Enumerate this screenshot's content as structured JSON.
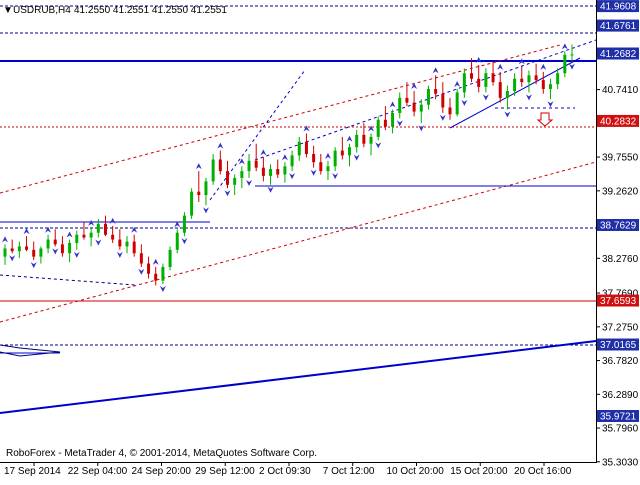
{
  "header": {
    "arrow": "▼",
    "symbol": "USDRUB,H4",
    "quote": "41.2550 41.2551 41.2550 41.2551"
  },
  "footer": {
    "copyright": "RoboForex - MetaTrader 4, © 2001-2014, MetaQuotes Software Corp."
  },
  "colors": {
    "background": "#ffffff",
    "bull_candle": "#00b000",
    "bear_candle": "#d00000",
    "trend_line": "#0000cc",
    "channel_dashed": "#cc0000",
    "support_dashed": "#000080",
    "horizontal_red": "#cc0000",
    "fractal_marker": "#3333cc",
    "price_label_blue_bg": "#1f2fa8",
    "price_label_red_bg": "#d01010"
  },
  "chart_data": {
    "type": "candlestick",
    "title": "USDRUB,H4",
    "ylim": [
      35.3,
      42.05
    ],
    "y_ticks": [
      "41.9608",
      "41.6761",
      "41.2682",
      "40.7410",
      "40.2832",
      "39.7550",
      "39.2620",
      "38.7629",
      "38.2760",
      "37.7690",
      "37.6593",
      "37.2750",
      "37.0165",
      "36.7820",
      "36.2890",
      "35.9721",
      "35.7960",
      "35.3030"
    ],
    "x_tick_labels": [
      "17 Sep 2014",
      "22 Sep 04:00",
      "24 Sep 20:00",
      "29 Sep 12:00",
      "2 Oct 09:30",
      "7 Oct 12:00",
      "10 Oct 20:00",
      "15 Oct 20:00",
      "20 Oct 16:00"
    ],
    "highlighted_levels": [
      {
        "value": 41.9608,
        "label": "41.9608",
        "style": "blue"
      },
      {
        "value": 41.6761,
        "label": "41.6761",
        "style": "blue"
      },
      {
        "value": 41.2682,
        "label": "41.2682",
        "style": "blue"
      },
      {
        "value": 40.2832,
        "label": "40.2832",
        "style": "red"
      },
      {
        "value": 38.7629,
        "label": "38.7629",
        "style": "blue"
      },
      {
        "value": 37.6593,
        "label": "37.6593",
        "style": "red"
      },
      {
        "value": 37.0165,
        "label": "37.0165",
        "style": "blue"
      },
      {
        "value": 35.9721,
        "label": "35.9721",
        "style": "blue"
      }
    ],
    "candles": [
      [
        38.3,
        38.48,
        38.18,
        38.42
      ],
      [
        38.42,
        38.55,
        38.35,
        38.38
      ],
      [
        38.38,
        38.52,
        38.28,
        38.45
      ],
      [
        38.45,
        38.6,
        38.38,
        38.4
      ],
      [
        38.4,
        38.52,
        38.25,
        38.3
      ],
      [
        38.3,
        38.45,
        38.2,
        38.42
      ],
      [
        38.42,
        38.62,
        38.35,
        38.55
      ],
      [
        38.55,
        38.7,
        38.45,
        38.48
      ],
      [
        38.48,
        38.6,
        38.3,
        38.35
      ],
      [
        38.35,
        38.55,
        38.22,
        38.5
      ],
      [
        38.5,
        38.68,
        38.4,
        38.62
      ],
      [
        38.62,
        38.8,
        38.55,
        38.58
      ],
      [
        38.58,
        38.72,
        38.45,
        38.65
      ],
      [
        38.65,
        38.85,
        38.58,
        38.78
      ],
      [
        38.78,
        38.9,
        38.6,
        38.62
      ],
      [
        38.62,
        38.75,
        38.5,
        38.55
      ],
      [
        38.55,
        38.7,
        38.4,
        38.45
      ],
      [
        38.45,
        38.6,
        38.35,
        38.52
      ],
      [
        38.52,
        38.62,
        38.3,
        38.35
      ],
      [
        38.35,
        38.48,
        38.15,
        38.2
      ],
      [
        38.2,
        38.3,
        37.98,
        38.05
      ],
      [
        38.05,
        38.15,
        37.88,
        37.95
      ],
      [
        37.95,
        38.2,
        37.9,
        38.15
      ],
      [
        38.15,
        38.45,
        38.1,
        38.4
      ],
      [
        38.4,
        38.7,
        38.35,
        38.65
      ],
      [
        38.65,
        38.95,
        38.6,
        38.9
      ],
      [
        38.9,
        39.3,
        38.85,
        39.25
      ],
      [
        39.25,
        39.55,
        39.1,
        39.2
      ],
      [
        39.2,
        39.45,
        39.05,
        39.4
      ],
      [
        39.4,
        39.8,
        39.35,
        39.72
      ],
      [
        39.72,
        39.85,
        39.5,
        39.55
      ],
      [
        39.55,
        39.7,
        39.3,
        39.35
      ],
      [
        39.35,
        39.5,
        39.2,
        39.45
      ],
      [
        39.45,
        39.62,
        39.3,
        39.55
      ],
      [
        39.55,
        39.8,
        39.45,
        39.7
      ],
      [
        39.7,
        39.95,
        39.55,
        39.6
      ],
      [
        39.6,
        39.75,
        39.4,
        39.48
      ],
      [
        39.48,
        39.65,
        39.35,
        39.58
      ],
      [
        39.58,
        39.72,
        39.45,
        39.5
      ],
      [
        39.5,
        39.68,
        39.38,
        39.62
      ],
      [
        39.62,
        39.85,
        39.55,
        39.78
      ],
      [
        39.78,
        40.05,
        39.7,
        39.98
      ],
      [
        39.98,
        40.1,
        39.75,
        39.8
      ],
      [
        39.8,
        39.92,
        39.6,
        39.68
      ],
      [
        39.68,
        39.8,
        39.5,
        39.55
      ],
      [
        39.55,
        39.7,
        39.42,
        39.62
      ],
      [
        39.62,
        39.9,
        39.55,
        39.85
      ],
      [
        39.85,
        40.05,
        39.72,
        39.78
      ],
      [
        39.78,
        39.95,
        39.62,
        39.9
      ],
      [
        39.9,
        40.15,
        39.82,
        40.08
      ],
      [
        40.08,
        40.25,
        39.9,
        39.95
      ],
      [
        39.95,
        40.1,
        39.78,
        40.05
      ],
      [
        40.05,
        40.35,
        40.0,
        40.3
      ],
      [
        40.3,
        40.5,
        40.15,
        40.2
      ],
      [
        40.2,
        40.45,
        40.1,
        40.4
      ],
      [
        40.4,
        40.7,
        40.32,
        40.62
      ],
      [
        40.62,
        40.85,
        40.5,
        40.55
      ],
      [
        40.55,
        40.72,
        40.35,
        40.42
      ],
      [
        40.42,
        40.6,
        40.25,
        40.52
      ],
      [
        40.52,
        40.8,
        40.45,
        40.75
      ],
      [
        40.75,
        40.95,
        40.6,
        40.68
      ],
      [
        40.68,
        40.85,
        40.4,
        40.48
      ],
      [
        40.48,
        40.62,
        40.3,
        40.38
      ],
      [
        40.38,
        40.75,
        40.35,
        40.7
      ],
      [
        40.7,
        41.05,
        40.62,
        40.98
      ],
      [
        40.98,
        41.2,
        40.85,
        40.9
      ],
      [
        40.9,
        41.1,
        40.7,
        40.78
      ],
      [
        40.78,
        41.05,
        40.7,
        40.98
      ],
      [
        40.98,
        41.15,
        40.8,
        40.85
      ],
      [
        40.85,
        41.0,
        40.55,
        40.62
      ],
      [
        40.62,
        40.8,
        40.45,
        40.72
      ],
      [
        40.72,
        40.98,
        40.65,
        40.9
      ],
      [
        40.9,
        41.08,
        40.78,
        40.85
      ],
      [
        40.85,
        41.02,
        40.7,
        40.95
      ],
      [
        40.95,
        41.12,
        40.82,
        40.88
      ],
      [
        40.88,
        41.0,
        40.68,
        40.75
      ],
      [
        40.75,
        40.9,
        40.6,
        40.82
      ],
      [
        40.82,
        41.05,
        40.75,
        40.98
      ],
      [
        40.98,
        41.3,
        40.92,
        41.25
      ],
      [
        41.25,
        41.4,
        41.15,
        41.2551
      ]
    ]
  }
}
